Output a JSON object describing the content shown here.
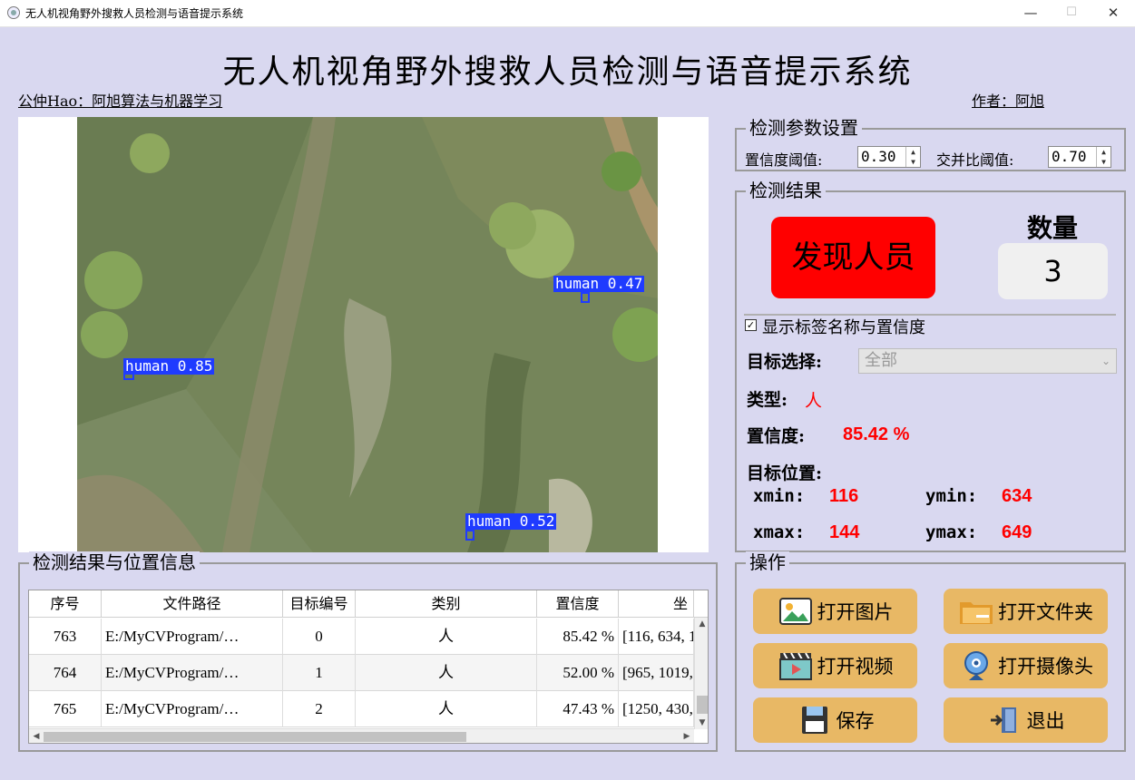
{
  "window": {
    "title": "无人机视角野外搜救人员检测与语音提示系统",
    "minimize_glyph": "—",
    "maximize_glyph": "☐",
    "close_glyph": "✕"
  },
  "header": {
    "title": "无人机视角野外搜救人员检测与语音提示系统",
    "left_link": "公仲Hao：阿旭算法与机器学习",
    "right_link": "作者：阿旭"
  },
  "detections": [
    {
      "label": "human 0.47"
    },
    {
      "label": "human 0.85"
    },
    {
      "label": "human 0.52"
    }
  ],
  "params": {
    "group_title": "检测参数设置",
    "conf_label": "置信度阈值:",
    "conf_value": "0.30",
    "iou_label": "交并比阈值:",
    "iou_value": "0.70"
  },
  "result": {
    "group_title": "检测结果",
    "found_text": "发现人员",
    "count_title": "数量",
    "count_value": "3",
    "show_label_checkbox": "显示标签名称与置信度",
    "target_select_label": "目标选择:",
    "target_select_value": "全部",
    "type_label": "类型:",
    "type_value": "人",
    "confidence_label": "置信度:",
    "confidence_value": "85.42 %",
    "position_label": "目标位置:",
    "xmin_label": "xmin:",
    "xmin_value": "116",
    "ymin_label": "ymin:",
    "ymin_value": "634",
    "xmax_label": "xmax:",
    "xmax_value": "144",
    "ymax_label": "ymax:",
    "ymax_value": "649"
  },
  "table": {
    "group_title": "检测结果与位置信息",
    "headers": [
      "序号",
      "文件路径",
      "目标编号",
      "类别",
      "置信度",
      "坐"
    ],
    "rows": [
      [
        "763",
        "E:/MyCVProgram/…",
        "0",
        "人",
        "85.42 %",
        "[116, 634, 1"
      ],
      [
        "764",
        "E:/MyCVProgram/…",
        "1",
        "人",
        "52.00 %",
        "[965, 1019,"
      ],
      [
        "765",
        "E:/MyCVProgram/…",
        "2",
        "人",
        "47.43 %",
        "[1250, 430,"
      ]
    ]
  },
  "operations": {
    "group_title": "操作",
    "open_image": "打开图片",
    "open_folder": "打开文件夹",
    "open_video": "打开视频",
    "open_camera": "打开摄像头",
    "save": "保存",
    "exit": "退出"
  },
  "colors": {
    "background": "#d9d8f0",
    "found_bg": "#ff0000",
    "value_red": "#ff0000",
    "button_bg": "#e8b865",
    "detection_blue": "#1f3bff"
  }
}
